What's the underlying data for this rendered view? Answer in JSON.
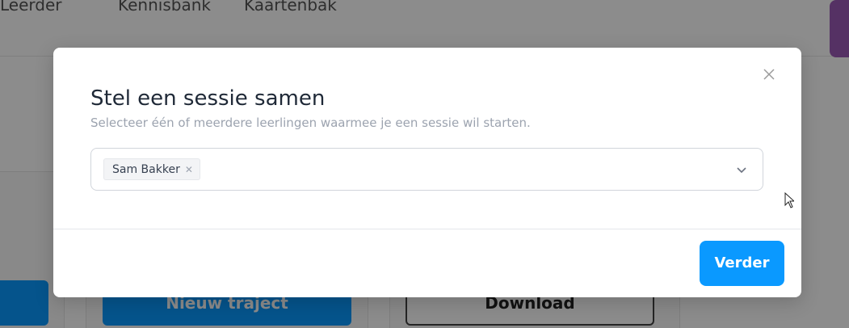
{
  "background": {
    "nav": [
      "Leerder",
      "Kennisbank",
      "Kaartenbak"
    ],
    "primary_button": "Nieuw traject",
    "secondary_button": "Download"
  },
  "modal": {
    "title": "Stel een sessie samen",
    "subtitle": "Selecteer één of meerdere leerlingen waarmee je een sessie wil starten.",
    "selected_students": [
      "Sam Bakker"
    ],
    "close_icon": "close-icon",
    "dropdown_icon": "chevron-down-icon",
    "continue_label": "Verder"
  },
  "colors": {
    "primary": "#0a99ff",
    "accent_purple": "#9b59b6"
  }
}
